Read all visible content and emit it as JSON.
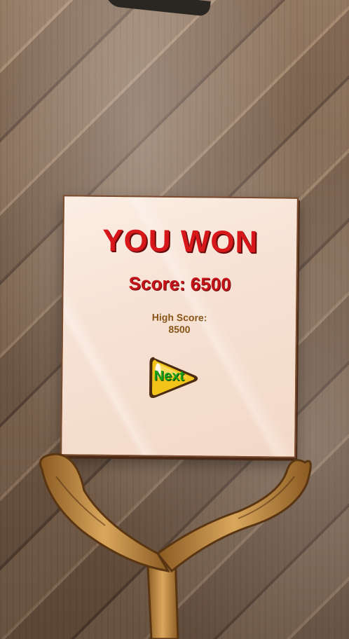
{
  "result": {
    "title": "YOU WON",
    "score_text": "Score: 6500",
    "high_score_label": "High Score:",
    "high_score_value": "8500"
  },
  "buttons": {
    "next_label": "Next"
  },
  "colors": {
    "title_red": "#d8171a",
    "high_score_brown": "#8a5418",
    "next_green": "#1aa11a",
    "button_yellow": "#f2c318",
    "paper": "#f6e1d3"
  }
}
